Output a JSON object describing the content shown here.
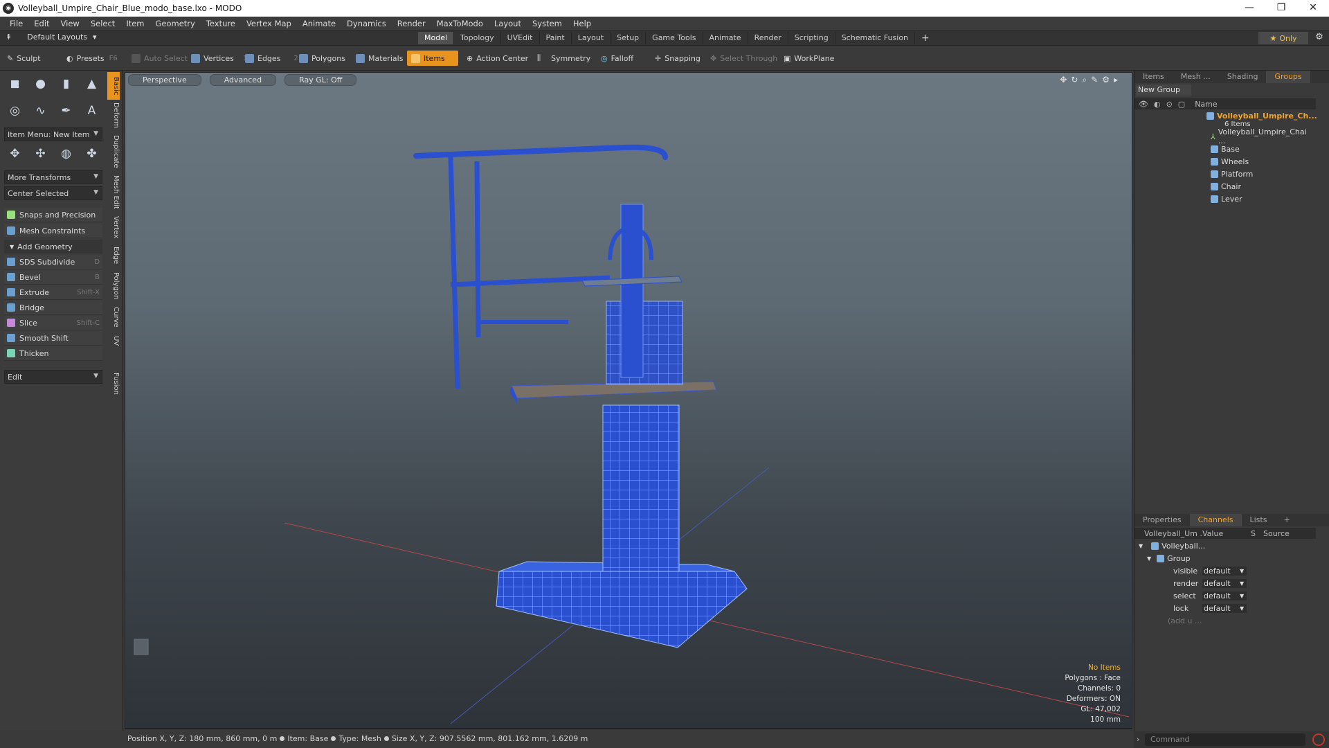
{
  "window": {
    "title": "Volleyball_Umpire_Chair_Blue_modo_base.lxo - MODO",
    "minimize": "—",
    "restore": "❐",
    "close": "✕"
  },
  "menu": [
    "File",
    "Edit",
    "View",
    "Select",
    "Item",
    "Geometry",
    "Texture",
    "Vertex Map",
    "Animate",
    "Dynamics",
    "Render",
    "MaxToModo",
    "Layout",
    "System",
    "Help"
  ],
  "layouts": {
    "label": "Default Layouts"
  },
  "mode_tabs": [
    {
      "label": "Model",
      "active": true
    },
    {
      "label": "Topology"
    },
    {
      "label": "UVEdit"
    },
    {
      "label": "Paint"
    },
    {
      "label": "Layout"
    },
    {
      "label": "Setup"
    },
    {
      "label": "Game Tools"
    },
    {
      "label": "Animate"
    },
    {
      "label": "Render"
    },
    {
      "label": "Scripting"
    },
    {
      "label": "Schematic Fusion"
    }
  ],
  "add_tab": "+",
  "only_label": "Only",
  "toolbar": {
    "sculpt": "Sculpt",
    "presets": "Presets",
    "presets_key": "F6",
    "auto_select": "Auto Select",
    "vertices": "Vertices",
    "vertices_num": "1",
    "edges": "Edges",
    "edges_num": "2",
    "polygons": "Polygons",
    "materials": "Materials",
    "items": "Items",
    "action_center": "Action Center",
    "symmetry": "Symmetry",
    "falloff": "Falloff",
    "snapping": "Snapping",
    "select_through": "Select Through",
    "workplane": "WorkPlane"
  },
  "left": {
    "item_menu": "Item Menu: New Item",
    "more_transforms": "More Transforms",
    "center_selected": "Center Selected",
    "snaps": "Snaps and Precision",
    "mesh_constraints": "Mesh Constraints",
    "add_geometry": "Add Geometry",
    "tools": [
      {
        "label": "SDS Subdivide",
        "key": "D"
      },
      {
        "label": "Bevel",
        "key": "B"
      },
      {
        "label": "Extrude",
        "key": "Shift-X"
      },
      {
        "label": "Bridge",
        "key": ""
      },
      {
        "label": "Slice",
        "key": "Shift-C"
      },
      {
        "label": "Smooth Shift",
        "key": ""
      },
      {
        "label": "Thicken",
        "key": ""
      }
    ],
    "edit": "Edit",
    "vtabs": [
      "Basic",
      "Deform",
      "Duplicate",
      "Mesh Edit",
      "Vertex",
      "Edge",
      "Polygon",
      "Curve",
      "UV",
      "Fusion"
    ]
  },
  "viewport": {
    "perspective": "Perspective",
    "advanced": "Advanced",
    "raygl": "Ray GL: Off",
    "info": {
      "items": "No Items",
      "polygons": "Polygons : Face",
      "channels": "Channels: 0",
      "deformers": "Deformers: ON",
      "gl": "GL: 47,002",
      "scale": "100 mm"
    }
  },
  "status": {
    "position": "Position X, Y, Z:  180 mm, 860 mm, 0 m",
    "item": "Item:  Base",
    "type": "Type:  Mesh",
    "size": "Size X, Y, Z:  907.5562 mm, 801.162 mm, 1.6209 m"
  },
  "right_top": {
    "tabs": [
      {
        "label": "Items"
      },
      {
        "label": "Mesh ..."
      },
      {
        "label": "Shading"
      },
      {
        "label": "Groups",
        "active": true
      }
    ],
    "new_group": "New Group",
    "col_name": "Name",
    "group_name": "Volleyball_Umpire_Ch...",
    "group_count": "6 Items",
    "children": [
      "Volleyball_Umpire_Chai ...",
      "Base",
      "Wheels",
      "Platform",
      "Chair",
      "Lever"
    ]
  },
  "right_bottom": {
    "tabs": [
      {
        "label": "Properties"
      },
      {
        "label": "Channels",
        "active": true
      },
      {
        "label": "Lists"
      },
      {
        "label": "+"
      }
    ],
    "col_item": "Volleyball_Um ...",
    "col_value": "Value",
    "col_s": "S",
    "col_source": "Source",
    "root": "Volleyball...",
    "group": "Group",
    "channels": [
      {
        "name": "visible",
        "value": "default"
      },
      {
        "name": "render",
        "value": "default"
      },
      {
        "name": "select",
        "value": "default"
      },
      {
        "name": "lock",
        "value": "default"
      }
    ],
    "add": "(add u ..."
  },
  "command": {
    "placeholder": "Command"
  },
  "colors": {
    "accent": "#e8941f",
    "mesh_blue": "#2a4fcf",
    "wire": "#8fb3ff"
  }
}
